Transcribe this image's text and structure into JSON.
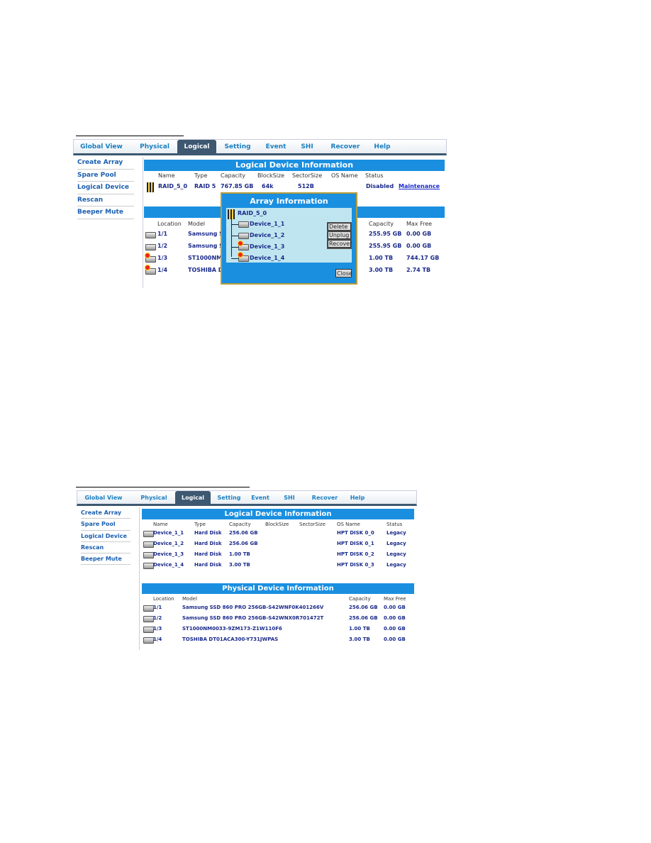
{
  "nav_tabs": [
    "Global View",
    "Physical",
    "Logical",
    "Setting",
    "Event",
    "SHI",
    "Recover",
    "Help"
  ],
  "active_tab": "Logical",
  "sidebar": [
    "Create Array",
    "Spare Pool",
    "Logical Device",
    "Rescan",
    "Beeper Mute"
  ],
  "shot1": {
    "logical_title": "Logical Device Information",
    "logical_headers": [
      "Name",
      "Type",
      "Capacity",
      "BlockSize",
      "SectorSize",
      "OS Name",
      "Status"
    ],
    "logical_row": {
      "name": "RAID_5_0",
      "type": "RAID 5",
      "capacity": "767.85 GB",
      "blocksize": "64k",
      "sectorsize": "512B",
      "os_name": "",
      "status": "Disabled",
      "link": "Maintenance"
    },
    "physical_headers": {
      "location": "Location",
      "model": "Model",
      "capacity": "Capacity",
      "max_free": "Max Free"
    },
    "physical_rows": [
      {
        "location": "1/1",
        "model": "Samsung SS",
        "capacity": "255.95 GB",
        "max_free": "0.00 GB",
        "failed": false
      },
      {
        "location": "1/2",
        "model": "Samsung SS",
        "capacity": "255.95 GB",
        "max_free": "0.00 GB",
        "failed": false
      },
      {
        "location": "1/3",
        "model": "ST1000NM0",
        "capacity": "1.00 TB",
        "max_free": "744.17 GB",
        "failed": true
      },
      {
        "location": "1/4",
        "model": "TOSHIBA DT",
        "capacity": "3.00 TB",
        "max_free": "2.74 TB",
        "failed": true
      }
    ],
    "popup": {
      "title": "Array Information",
      "array": "RAID_5_0",
      "devices": [
        {
          "name": "Device_1_1",
          "failed": false
        },
        {
          "name": "Device_1_2",
          "failed": false
        },
        {
          "name": "Device_1_3",
          "failed": true
        },
        {
          "name": "Device_1_4",
          "failed": true
        }
      ],
      "buttons": [
        "Delete",
        "Unplug",
        "Recover"
      ],
      "close": "Close"
    }
  },
  "shot2": {
    "logical_title": "Logical Device Information",
    "logical_headers": [
      "Name",
      "Type",
      "Capacity",
      "BlockSize",
      "SectorSize",
      "OS Name",
      "Status"
    ],
    "logical_rows": [
      {
        "name": "Device_1_1",
        "type": "Hard Disk",
        "capacity": "256.06 GB",
        "os_name": "HPT DISK 0_0",
        "status": "Legacy"
      },
      {
        "name": "Device_1_2",
        "type": "Hard Disk",
        "capacity": "256.06 GB",
        "os_name": "HPT DISK 0_1",
        "status": "Legacy"
      },
      {
        "name": "Device_1_3",
        "type": "Hard Disk",
        "capacity": "1.00 TB",
        "os_name": "HPT DISK 0_2",
        "status": "Legacy"
      },
      {
        "name": "Device_1_4",
        "type": "Hard Disk",
        "capacity": "3.00 TB",
        "os_name": "HPT DISK 0_3",
        "status": "Legacy"
      }
    ],
    "physical_title": "Physical Device Information",
    "physical_headers": {
      "location": "Location",
      "model": "Model",
      "capacity": "Capacity",
      "max_free": "Max Free"
    },
    "physical_rows": [
      {
        "location": "1/1",
        "model": "Samsung SSD 860 PRO 256GB-S42WNF0K401266V",
        "capacity": "256.06 GB",
        "max_free": "0.00 GB"
      },
      {
        "location": "1/2",
        "model": "Samsung SSD 860 PRO 256GB-S42WNX0R701472T",
        "capacity": "256.06 GB",
        "max_free": "0.00 GB"
      },
      {
        "location": "1/3",
        "model": "ST1000NM0033-9ZM173-Z1W110F6",
        "capacity": "1.00 TB",
        "max_free": "0.00 GB"
      },
      {
        "location": "1/4",
        "model": "TOSHIBA DT01ACA300-Y731JWPAS",
        "capacity": "3.00 TB",
        "max_free": "0.00 GB"
      }
    ]
  }
}
